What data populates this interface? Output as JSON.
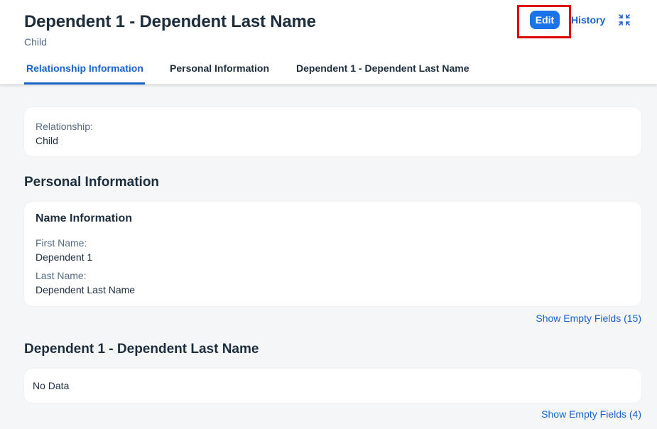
{
  "header": {
    "title": "Dependent 1 - Dependent Last Name",
    "subtitle": "Child",
    "edit_label": "Edit",
    "history_label": "History",
    "collapse_icon": "collapse-header-icon"
  },
  "tabs": [
    {
      "label": "Relationship Information",
      "active": true
    },
    {
      "label": "Personal Information",
      "active": false
    },
    {
      "label": "Dependent 1 - Dependent Last Name",
      "active": false
    }
  ],
  "relationship": {
    "label": "Relationship:",
    "value": "Child"
  },
  "personal": {
    "section_title": "Personal Information",
    "card_title": "Name Information",
    "first_name_label": "First Name:",
    "first_name_value": "Dependent 1",
    "last_name_label": "Last Name:",
    "last_name_value": "Dependent Last Name",
    "show_empty": "Show Empty Fields (15)"
  },
  "dependent": {
    "section_title": "Dependent 1 - Dependent Last Name",
    "no_data": "No Data",
    "show_empty": "Show Empty Fields (4)"
  },
  "colors": {
    "accent": "#1a64c8",
    "edit_button": "#1a73e8",
    "highlight": "#e00000",
    "background": "#f5f6f7"
  }
}
